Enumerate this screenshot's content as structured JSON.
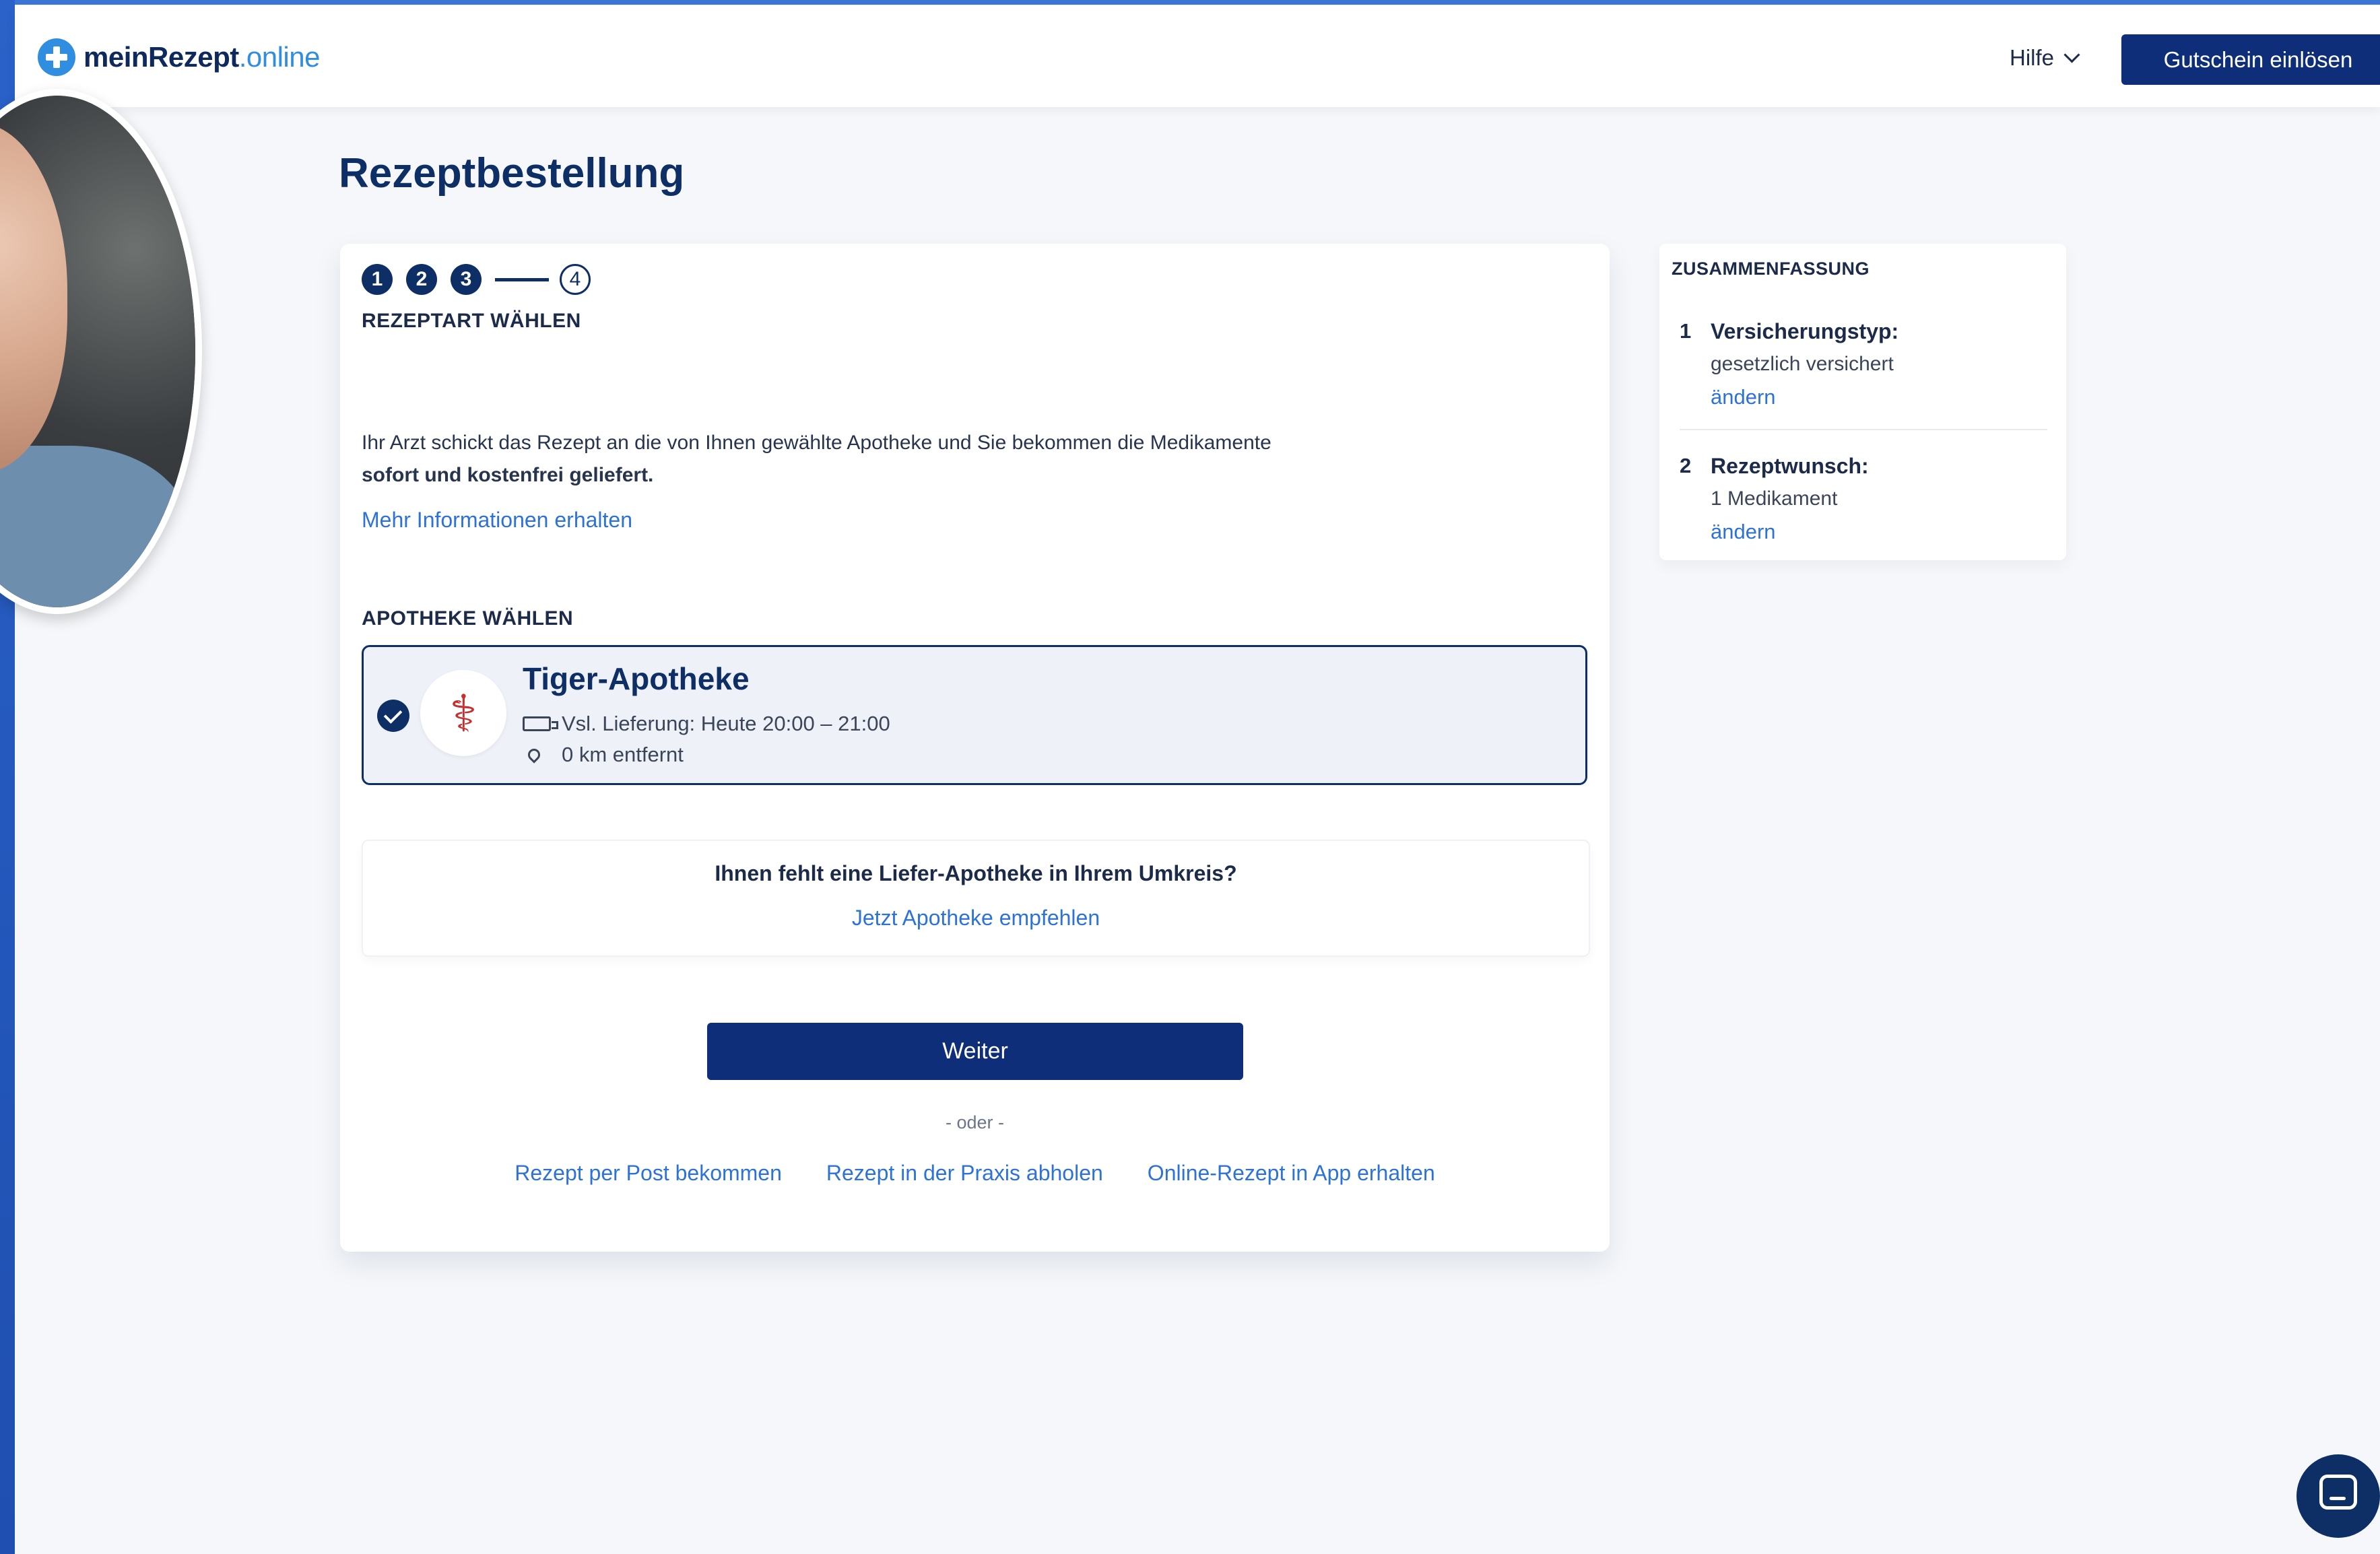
{
  "header": {
    "logo_main": "meinRezept",
    "logo_tld": ".online",
    "help_label": "Hilfe",
    "voucher_label": "Gutschein einlösen"
  },
  "page": {
    "title": "Rezeptbestellung"
  },
  "steps": {
    "done": [
      "1",
      "2",
      "3"
    ],
    "current": "4",
    "current_label": "REZEPTART WÄHLEN"
  },
  "info": {
    "text": "Ihr Arzt schickt das Rezept an die von Ihnen gewählte Apotheke und Sie bekommen die Medikamente",
    "bold": "sofort und kostenfrei geliefert.",
    "more_link": "Mehr Informationen erhalten"
  },
  "pharmacy_section": {
    "label": "APOTHEKE WÄHLEN",
    "selected": {
      "name": "Tiger-Apotheke",
      "delivery": "Vsl. Lieferung: Heute 20:00 – 21:00",
      "distance": "0 km entfernt",
      "logo_glyph": "⚕"
    },
    "missing_question": "Ihnen fehlt eine Liefer-Apotheke in Ihrem Umkreis?",
    "missing_link": "Jetzt Apotheke empfehlen"
  },
  "actions": {
    "primary": "Weiter",
    "or": "- oder -",
    "alternatives": [
      "Rezept per Post bekommen",
      "Rezept in der Praxis abholen",
      "Online-Rezept in App erhalten"
    ]
  },
  "summary": {
    "title": "ZUSAMMENFASSUNG",
    "items": [
      {
        "num": "1",
        "heading": "Versicherungstyp:",
        "value": "gesetzlich versichert",
        "link": "ändern"
      },
      {
        "num": "2",
        "heading": "Rezeptwunsch:",
        "value": "1 Medikament",
        "link": "ändern"
      }
    ]
  },
  "colors": {
    "primary": "#0e2e66",
    "link": "#2d72d9",
    "logo_blue": "#2f8ee0"
  },
  "icons": {
    "chat": "chat-bubble-icon",
    "check": "check-icon",
    "truck": "truck-icon",
    "pin": "map-pin-icon"
  }
}
